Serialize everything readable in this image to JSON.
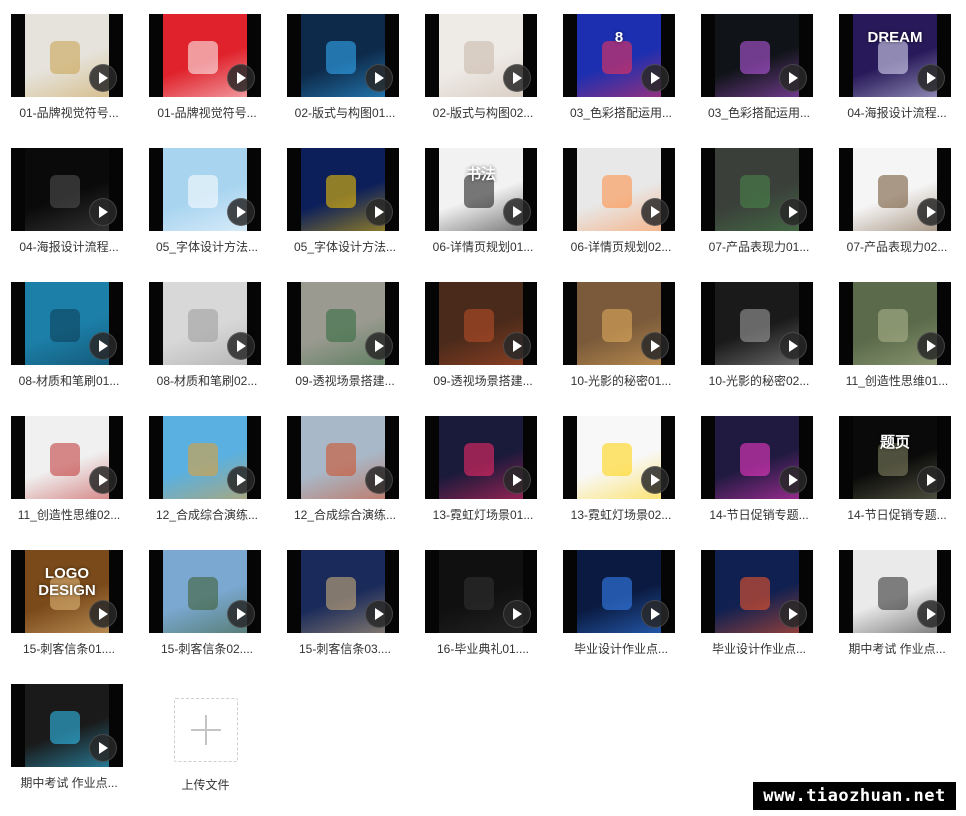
{
  "files": [
    {
      "label": "01-品牌视觉符号...",
      "preview_bg": "#e6e3dc",
      "accent": "#c8a04a",
      "caption": ""
    },
    {
      "label": "01-品牌视觉符号...",
      "preview_bg": "#e0222c",
      "accent": "#ffffff",
      "caption": ""
    },
    {
      "label": "02-版式与构图01...",
      "preview_bg": "#0d2a4a",
      "accent": "#35b3ff",
      "caption": ""
    },
    {
      "label": "02-版式与构图02...",
      "preview_bg": "#eeeae6",
      "accent": "#c9b7a7",
      "caption": ""
    },
    {
      "label": "03_色彩搭配运用...",
      "preview_bg": "#1b2fb0",
      "accent": "#ff3355",
      "caption": "8"
    },
    {
      "label": "03_色彩搭配运用...",
      "preview_bg": "#101418",
      "accent": "#c35cf0",
      "caption": ""
    },
    {
      "label": "04-海报设计流程...",
      "preview_bg": "#281a5a",
      "accent": "#e6e6ff",
      "caption": "DREAM"
    },
    {
      "label": "04-海报设计流程...",
      "preview_bg": "#0a0a0a",
      "accent": "#555555",
      "caption": ""
    },
    {
      "label": "05_字体设计方法...",
      "preview_bg": "#a8d4f0",
      "accent": "#ffffff",
      "caption": ""
    },
    {
      "label": "05_字体设计方法...",
      "preview_bg": "#0c1f5a",
      "accent": "#ffcc00",
      "caption": ""
    },
    {
      "label": "06-详情页规划01...",
      "preview_bg": "#f2f2f2",
      "accent": "#111111",
      "caption": "书法"
    },
    {
      "label": "06-详情页规划02...",
      "preview_bg": "#e8e8e8",
      "accent": "#ff8a3d",
      "caption": ""
    },
    {
      "label": "07-产品表现力01...",
      "preview_bg": "#3a3f3a",
      "accent": "#4a8a4a",
      "caption": ""
    },
    {
      "label": "07-产品表现力02...",
      "preview_bg": "#f5f5f5",
      "accent": "#6a4a2a",
      "caption": ""
    },
    {
      "label": "08-材质和笔刷01...",
      "preview_bg": "#1c7fa8",
      "accent": "#0d3a52",
      "caption": ""
    },
    {
      "label": "08-材质和笔刷02...",
      "preview_bg": "#d8d8d8",
      "accent": "#9a9a9a",
      "caption": ""
    },
    {
      "label": "09-透视场景搭建...",
      "preview_bg": "#9a9a90",
      "accent": "#2e6a3a",
      "caption": ""
    },
    {
      "label": "09-透视场景搭建...",
      "preview_bg": "#4a2a1a",
      "accent": "#c0502a",
      "caption": ""
    },
    {
      "label": "10-光影的秘密01...",
      "preview_bg": "#7a5a3a",
      "accent": "#e8b060",
      "caption": ""
    },
    {
      "label": "10-光影的秘密02...",
      "preview_bg": "#1a1a1a",
      "accent": "#aaaaaa",
      "caption": ""
    },
    {
      "label": "11_创造性思维01...",
      "preview_bg": "#5a6a4a",
      "accent": "#b0b890",
      "caption": ""
    },
    {
      "label": "11_创造性思维02...",
      "preview_bg": "#f0f0f0",
      "accent": "#c03030",
      "caption": ""
    },
    {
      "label": "12_合成综合演练...",
      "preview_bg": "#5ab0e0",
      "accent": "#e8a030",
      "caption": ""
    },
    {
      "label": "12_合成综合演练...",
      "preview_bg": "#a8b8c8",
      "accent": "#d04a20",
      "caption": ""
    },
    {
      "label": "13-霓虹灯场景01...",
      "preview_bg": "#1a1a3a",
      "accent": "#ff2a6a",
      "caption": ""
    },
    {
      "label": "13-霓虹灯场景02...",
      "preview_bg": "#f8f8f8",
      "accent": "#ffd200",
      "caption": ""
    },
    {
      "label": "14-节日促销专题...",
      "preview_bg": "#201a40",
      "accent": "#ff3ad0",
      "caption": ""
    },
    {
      "label": "14-节日促销专题...",
      "preview_bg": "#0a0a0a",
      "accent": "#8a8a6a",
      "caption": "题页"
    },
    {
      "label": "15-刺客信条01....",
      "preview_bg": "#7a4a1a",
      "accent": "#e8c080",
      "caption": "LOGO DESIGN"
    },
    {
      "label": "15-刺客信条02....",
      "preview_bg": "#7aa8d0",
      "accent": "#3a5a2a",
      "caption": ""
    },
    {
      "label": "15-刺客信条03....",
      "preview_bg": "#1a2a5a",
      "accent": "#d8b880",
      "caption": ""
    },
    {
      "label": "16-毕业典礼01....",
      "preview_bg": "#101010",
      "accent": "#333333",
      "caption": ""
    },
    {
      "label": "毕业设计作业点...",
      "preview_bg": "#0a1a40",
      "accent": "#3a8aff",
      "caption": ""
    },
    {
      "label": "毕业设计作业点...",
      "preview_bg": "#102050",
      "accent": "#ff5a2a",
      "caption": ""
    },
    {
      "label": "期中考试 作业点...",
      "preview_bg": "#eaeaea",
      "accent": "#222222",
      "caption": ""
    },
    {
      "label": "期中考试 作业点...",
      "preview_bg": "#1a1a1a",
      "accent": "#33ccff",
      "caption": ""
    }
  ],
  "upload": {
    "label": "上传文件",
    "icon": "plus-icon"
  },
  "watermark": "www.tiaozhuan.net",
  "icons": {
    "play": "play-icon"
  }
}
